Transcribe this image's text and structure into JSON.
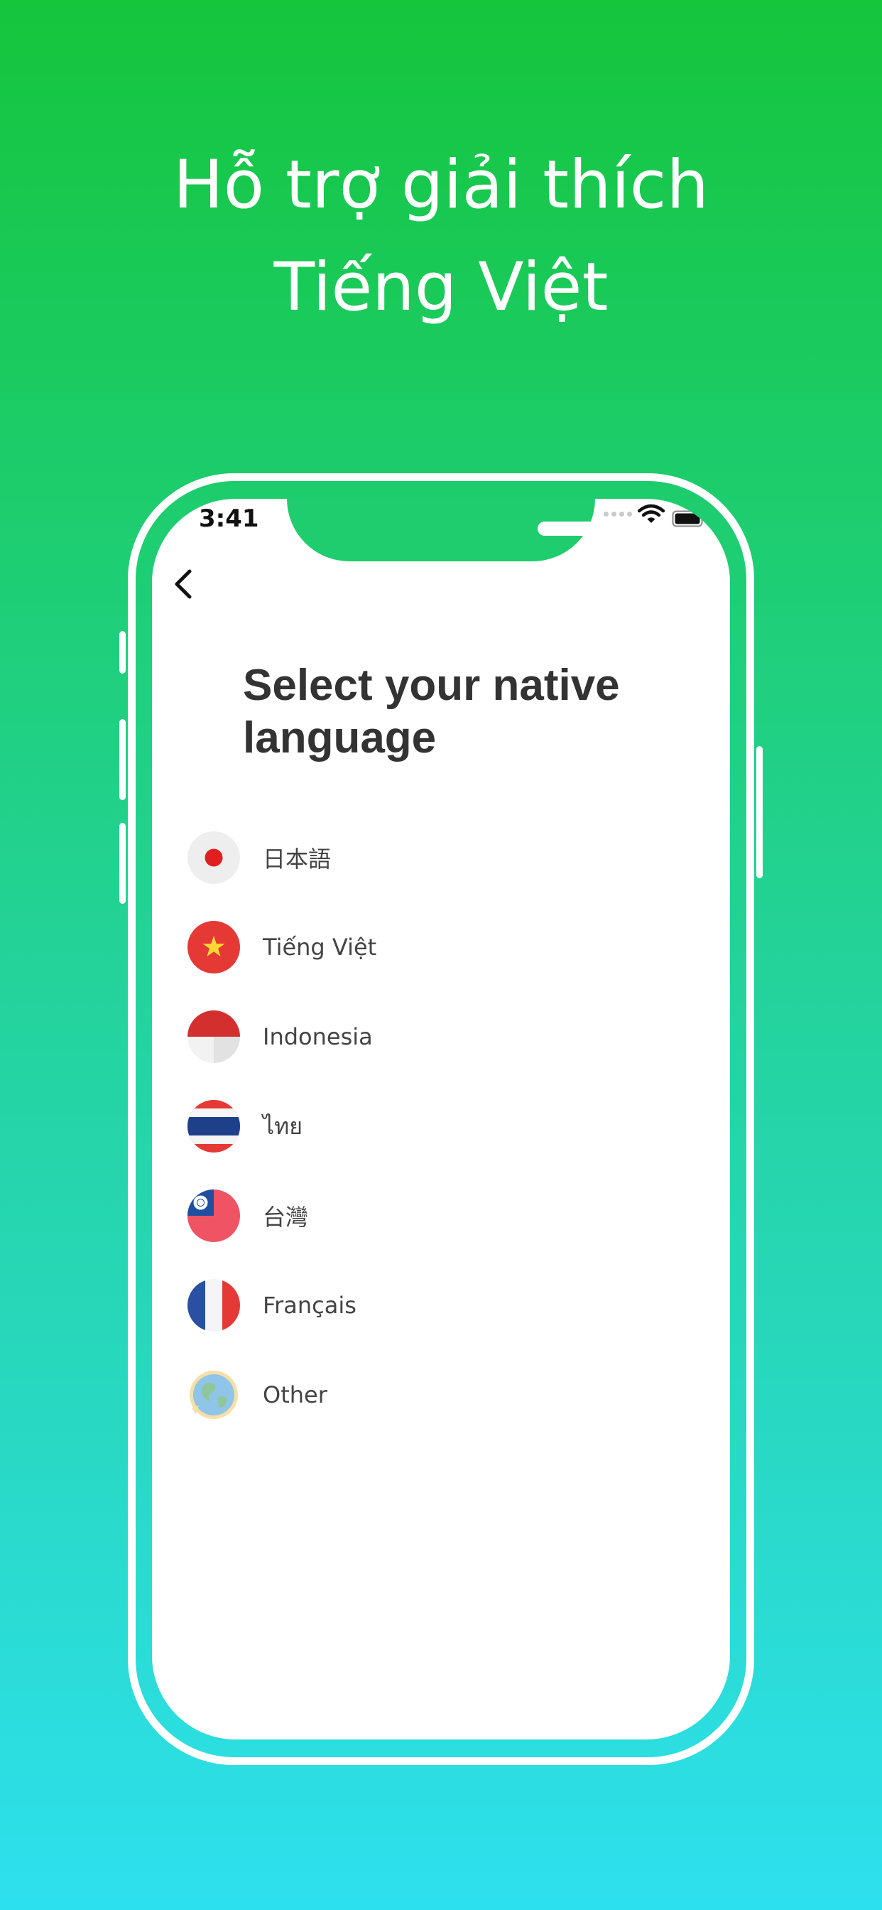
{
  "promo": {
    "headline_line1": "Hỗ trợ giải thích",
    "headline_line2": "Tiếng Việt"
  },
  "status_bar": {
    "time": "3:41"
  },
  "screen": {
    "title": "Select your native language",
    "languages": [
      {
        "label": "日本語",
        "icon": "japan-flag-icon"
      },
      {
        "label": "Tiếng Việt",
        "icon": "vietnam-flag-icon"
      },
      {
        "label": "Indonesia",
        "icon": "indonesia-flag-icon"
      },
      {
        "label": "ไทย",
        "icon": "thailand-flag-icon"
      },
      {
        "label": "台灣",
        "icon": "taiwan-flag-icon"
      },
      {
        "label": "Français",
        "icon": "france-flag-icon"
      },
      {
        "label": "Other",
        "icon": "globe-icon"
      }
    ]
  },
  "colors": {
    "gradient_top": "#15c53c",
    "gradient_bottom": "#2de0ee",
    "title_text": "#333333"
  }
}
